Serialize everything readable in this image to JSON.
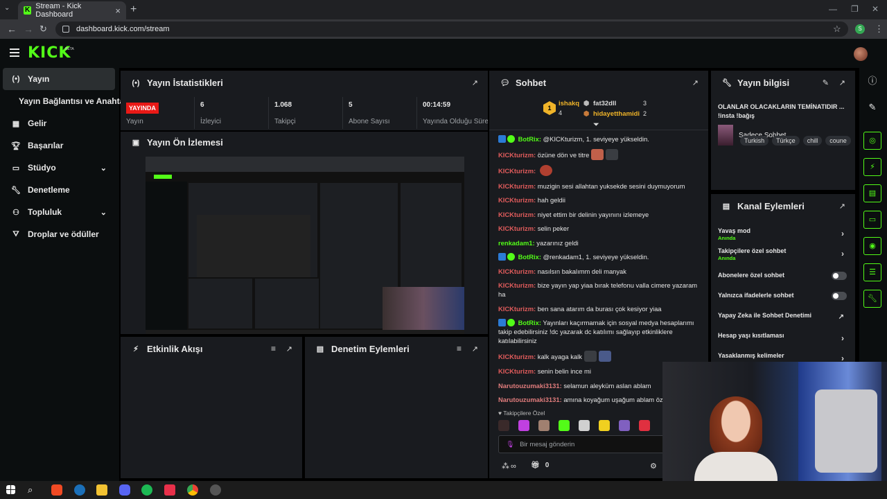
{
  "browser": {
    "tab_title": "Stream - Kick Dashboard",
    "url": "dashboard.kick.com/stream",
    "profile_initial": "S"
  },
  "header": {
    "logo": "KICK",
    "beta": "BETA"
  },
  "sidebar": {
    "items": [
      {
        "label": "Yayın",
        "icon": "broadcast-icon"
      },
      {
        "label": "Yayın Bağlantısı ve Anahtarı"
      },
      {
        "label": "Gelir",
        "icon": "revenue-icon"
      },
      {
        "label": "Başarılar",
        "icon": "trophy-icon"
      },
      {
        "label": "Stüdyo",
        "icon": "studio-icon"
      },
      {
        "label": "Denetleme",
        "icon": "wrench-icon"
      },
      {
        "label": "Topluluk",
        "icon": "community-icon"
      },
      {
        "label": "Droplar ve ödüller",
        "icon": "gift-icon"
      }
    ]
  },
  "stats_panel": {
    "title": "Yayın İstatistikleri",
    "live_badge": "YAYINDA",
    "live_label": "Yayın",
    "stats": [
      {
        "value": "6",
        "label": "İzleyici"
      },
      {
        "value": "1.068",
        "label": "Takipçi"
      },
      {
        "value": "5",
        "label": "Abone Sayısı"
      },
      {
        "value": "00:14:59",
        "label": "Yayında Olduğu Süre"
      }
    ]
  },
  "preview_panel": {
    "title": "Yayın Ön İzlemesi"
  },
  "activity_panel": {
    "title": "Etkinlik Akışı"
  },
  "moderation_panel": {
    "title": "Denetim Eylemleri"
  },
  "chat": {
    "title": "Sohbet",
    "gifters": [
      {
        "rank": "1",
        "name": "ishakq",
        "count": "4"
      },
      {
        "rank": "2",
        "name": "fat32dll",
        "count": "3"
      },
      {
        "rank": "3",
        "name": "hidayetthamidi",
        "count": "2"
      }
    ],
    "messages": [
      {
        "user": "BotRix:",
        "text": "@KICKturizm, 1. seviyeye yükseldin.",
        "type": "bot"
      },
      {
        "user": "KICKturizm:",
        "text": "özüne dön ve titre",
        "type": "kick"
      },
      {
        "user": "KICKturizm:",
        "text": "",
        "type": "kick"
      },
      {
        "user": "KICKturizm:",
        "text": "muzigin sesi allahtan yuksekde sesini duymuyorum",
        "type": "kick"
      },
      {
        "user": "KICKturizm:",
        "text": "hah geldii",
        "type": "kick"
      },
      {
        "user": "KICKturizm:",
        "text": "niyet ettim bir delinin yayınını izlemeye",
        "type": "kick"
      },
      {
        "user": "KICKturizm:",
        "text": "selin peker",
        "type": "kick"
      },
      {
        "user": "renkadam1:",
        "text": "yazarınız geldi",
        "type": "ren"
      },
      {
        "user": "BotRix:",
        "text": "@renkadam1, 1. seviyeye yükseldin.",
        "type": "bot"
      },
      {
        "user": "KICKturizm:",
        "text": "nasılsın bakalımm deli manyak",
        "type": "kick"
      },
      {
        "user": "KICKturizm:",
        "text": "bize yayın yap yiaa bırak telefonu valla cimere yazaram ha",
        "type": "kick"
      },
      {
        "user": "KICKturizm:",
        "text": "ben sana atarım da burası çok kesiyor yiaa",
        "type": "kick"
      },
      {
        "user": "BotRix:",
        "text": "Yayınları kaçırmamak için sosyal medya hesaplarımı takip edebilirsiniz !dc yazarak dc katılımı sağlayıp etkinliklere katılabilirsiniz",
        "type": "bot"
      },
      {
        "user": "KICKturizm:",
        "text": "kalk ayaga kalk",
        "type": "kick"
      },
      {
        "user": "KICKturizm:",
        "text": "senin belin ince mi",
        "type": "kick"
      },
      {
        "user": "Narutouzumaki3131:",
        "text": "selamun aleyküm aslan ablam",
        "type": "naru"
      },
      {
        "user": "Narutouzumaki3131:",
        "text": "amına koyağum uşağum ablam özlec",
        "type": "naru"
      }
    ],
    "followers_only": "Takipçilere Özel",
    "input_placeholder": "Bir mesaj gönderin",
    "points": "∞",
    "gift_count": "0"
  },
  "stream_info": {
    "title": "Yayın bilgisi",
    "stream_title": "OLANLAR OLACAKLARIN TEMİNATIDIR ... !insta !bağış",
    "category": "Sadece Sohbet",
    "tags": [
      "Turkish",
      "Türkçe",
      "chill",
      "coune"
    ]
  },
  "channel_actions": {
    "title": "Kanal Eylemleri",
    "items": [
      {
        "label": "Yavaş mod",
        "sub": "Anında",
        "control": "arrow"
      },
      {
        "label": "Takipçilere özel sohbet",
        "sub": "Anında",
        "control": "arrow"
      },
      {
        "label": "Abonelere özel sohbet",
        "sub": "",
        "control": "toggle"
      },
      {
        "label": "Yalnızca ifadelerle sohbet",
        "sub": "",
        "control": "toggle"
      },
      {
        "label": "Yapay Zeka ile Sohbet Denetimi",
        "sub": "",
        "control": "external"
      },
      {
        "label": "Hesap yaşı kısıtlaması",
        "sub": "",
        "control": "arrow"
      },
      {
        "label": "Yasaklanmış kelimeler",
        "sub": "",
        "control": "arrow"
      }
    ]
  },
  "colors": {
    "accent": "#53fc18",
    "live": "#e91916",
    "panel": "#191b1f",
    "background": "#000000"
  }
}
